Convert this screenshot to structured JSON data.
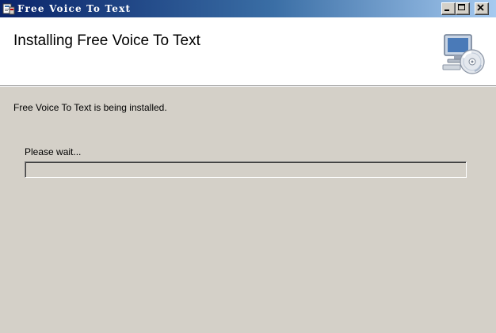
{
  "window": {
    "title": "Free Voice To Text"
  },
  "header": {
    "title": "Installing Free Voice To Text"
  },
  "main": {
    "status_text": "Free Voice To Text is being installed.",
    "wait_label": "Please wait...",
    "progress": 0
  },
  "icons": {
    "app": "installer-app-icon",
    "setup": "computer-cd-icon",
    "minimize": "minimize-icon",
    "maximize": "maximize-icon",
    "close": "close-icon"
  },
  "colors": {
    "titlebar_start": "#0a246a",
    "titlebar_end": "#a6caf0",
    "dialog_background": "#d4d0c8",
    "header_background": "#ffffff"
  }
}
